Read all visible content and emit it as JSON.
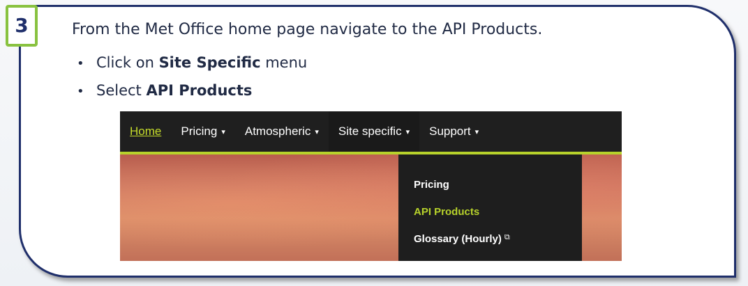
{
  "step": {
    "number": "3"
  },
  "instruction": {
    "intro": "From the Met Office home page navigate to the API Products.",
    "bullets": [
      {
        "prefix": "Click on ",
        "bold": "Site Specific",
        "suffix": " menu"
      },
      {
        "prefix": "Select ",
        "bold": "API Products",
        "suffix": ""
      }
    ]
  },
  "nav": {
    "home": "Home",
    "items": [
      {
        "label": "Pricing"
      },
      {
        "label": "Atmospheric"
      },
      {
        "label": "Site specific"
      },
      {
        "label": "Support"
      }
    ],
    "caret": "▾"
  },
  "dropdown": {
    "items": [
      {
        "label": "Pricing"
      },
      {
        "label": "API Products"
      },
      {
        "label": "Glossary (Hourly)"
      }
    ],
    "external_icon": "⧉"
  },
  "colors": {
    "accent_green": "#b7d22b",
    "badge_green": "#89c240",
    "card_border": "#1f2f6b",
    "nav_bg": "#1f1f1f"
  }
}
